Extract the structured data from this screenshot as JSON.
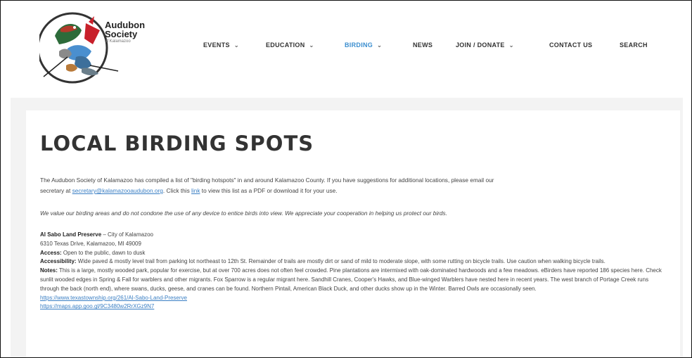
{
  "logo": {
    "line1": "Audubon",
    "line2": "Society",
    "line3": "of Kalamazoo"
  },
  "nav": [
    {
      "label": "EVENTS",
      "dropdown": true
    },
    {
      "label": "EDUCATION",
      "dropdown": true
    },
    {
      "label": "BIRDING",
      "dropdown": true,
      "active": true
    },
    {
      "label": "NEWS",
      "dropdown": false
    },
    {
      "label": "JOIN / DONATE",
      "dropdown": true
    },
    {
      "label": "CONTACT US",
      "dropdown": false
    },
    {
      "label": "SEARCH",
      "dropdown": false
    }
  ],
  "page": {
    "title": "LOCAL BIRDING SPOTS",
    "intro_1": "The Audubon Society of Kalamazoo has compiled a list of \"birding hotspots\" in and around Kalamazoo County. If you have suggestions for additional locations, please email our",
    "intro_2a": "secretary at ",
    "intro_email": "secretary@kalamazooaudubon.org",
    "intro_2b": ". Click this ",
    "intro_link": "link",
    "intro_2c": " to view this list as a PDF or download it for your use.",
    "notice": "We value our birding areas and do not condone the use of any device to entice birds into view. We appreciate your cooperation in helping us protect our birds."
  },
  "entry": {
    "name": "Al Sabo Land Preserve",
    "owner": " – City of Kalamazoo",
    "address": "6310 Texas Drive, Kalamazoo, MI 49009",
    "access_label": "Access:",
    "access": " Open to the public, dawn to dusk",
    "accessibility_label": "Accessibility:",
    "accessibility": " Wide paved & mostly level trail from parking lot northeast to 12th St. Remainder of trails are mostly dirt or sand of mild to moderate slope, with some rutting on bicycle trails. Use caution when walking bicycle trails.",
    "notes_label": "Notes:",
    "notes": " This is a large, mostly wooded park, popular for exercise, but at over 700 acres does not often feel crowded. Pine plantations are intermixed with oak-dominated hardwoods and a few meadows. eBirders have reported 186 species here. Check sunlit wooded edges in Spring & Fall for warblers and other migrants. Fox Sparrow is a regular migrant here. Sandhill Cranes, Cooper's Hawks, and Blue-winged Warblers have nested here in recent years. The west branch of Portage Creek runs through the back (north end), where swans, ducks, geese, and cranes can be found. Northern Pintail, American Black Duck, and other ducks show up in the Winter. Barred Owls are occasionally seen.",
    "link1": "https://www.texastownship.org/261/Al-Sabo-Land-Preserve",
    "link2": "https://maps.app.goo.gl/9C3480w2RrXGz9N7"
  }
}
